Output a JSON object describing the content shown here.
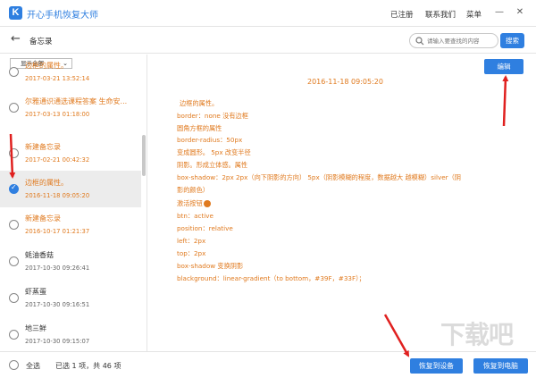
{
  "app": {
    "title": "开心手机恢复大师",
    "logo_letter": "K"
  },
  "titlebar": {
    "registered": "已注册",
    "contact": "联系我们",
    "menu": "菜单",
    "min": "—",
    "close": "✕"
  },
  "toolbar": {
    "back": "←",
    "title": "备忘录",
    "search_placeholder": "请输入要查找的内容",
    "search_button": "搜索"
  },
  "left": {
    "filter": "显示全部",
    "items": [
      {
        "title": "边框的属性。",
        "date": "2017-03-21 13:52:14",
        "checked": false,
        "color": "orange"
      },
      {
        "title": "尔雅通识通选课程答案 生命安...",
        "date": "2017-03-13 01:18:00",
        "checked": false,
        "color": "orange"
      },
      {
        "title": "新建备忘录",
        "date": "2017-02-21 00:42:32",
        "checked": false,
        "color": "orange"
      },
      {
        "title": "边框的属性。",
        "date": "2016-11-18 09:05:20",
        "checked": true,
        "color": "orange"
      },
      {
        "title": "新建备忘录",
        "date": "2016-10-17 01:21:37",
        "checked": false,
        "color": "orange"
      },
      {
        "title": "蚝油香菇",
        "date": "2017-10-30 09:26:41",
        "checked": false,
        "color": "grey"
      },
      {
        "title": "虾蒸蛋",
        "date": "2017-10-30 09:16:51",
        "checked": false,
        "color": "grey"
      },
      {
        "title": "地三鲜",
        "date": "2017-10-30 09:15:07",
        "checked": false,
        "color": "grey"
      }
    ]
  },
  "note": {
    "edit_button": "编辑",
    "date": "2016-11-18 09:05:20",
    "lines": [
      "边框的属性。",
      "border：none    没有边框",
      "圆角方框的属性",
      "border-radius：50px",
      "变成圆形。        5px    改变半径",
      "阴影。形成立体感。属性",
      "box-shadow：2px     2px（向下阴影的方向）      5px（阴影模糊的程度，数据越大 越模糊）silver（阴",
      "影的颜色）",
      "激活按钮",
      "btn：active",
      "position：relative",
      "left：2px",
      "top：2px",
      "box-shadow 变换阴影",
      "blackground：linear-gradient（to bottom，#39F，#33F）；"
    ]
  },
  "bottom": {
    "select_all": "全选",
    "selection_info": "已选 1 项，共 46 项",
    "restore_device": "恢复到设备",
    "restore_pc": "恢复到电脑"
  },
  "watermark": "下载吧",
  "colors": {
    "accent": "#2f7fe0",
    "note_text": "#e07a1f",
    "arrow": "#e0201f"
  }
}
